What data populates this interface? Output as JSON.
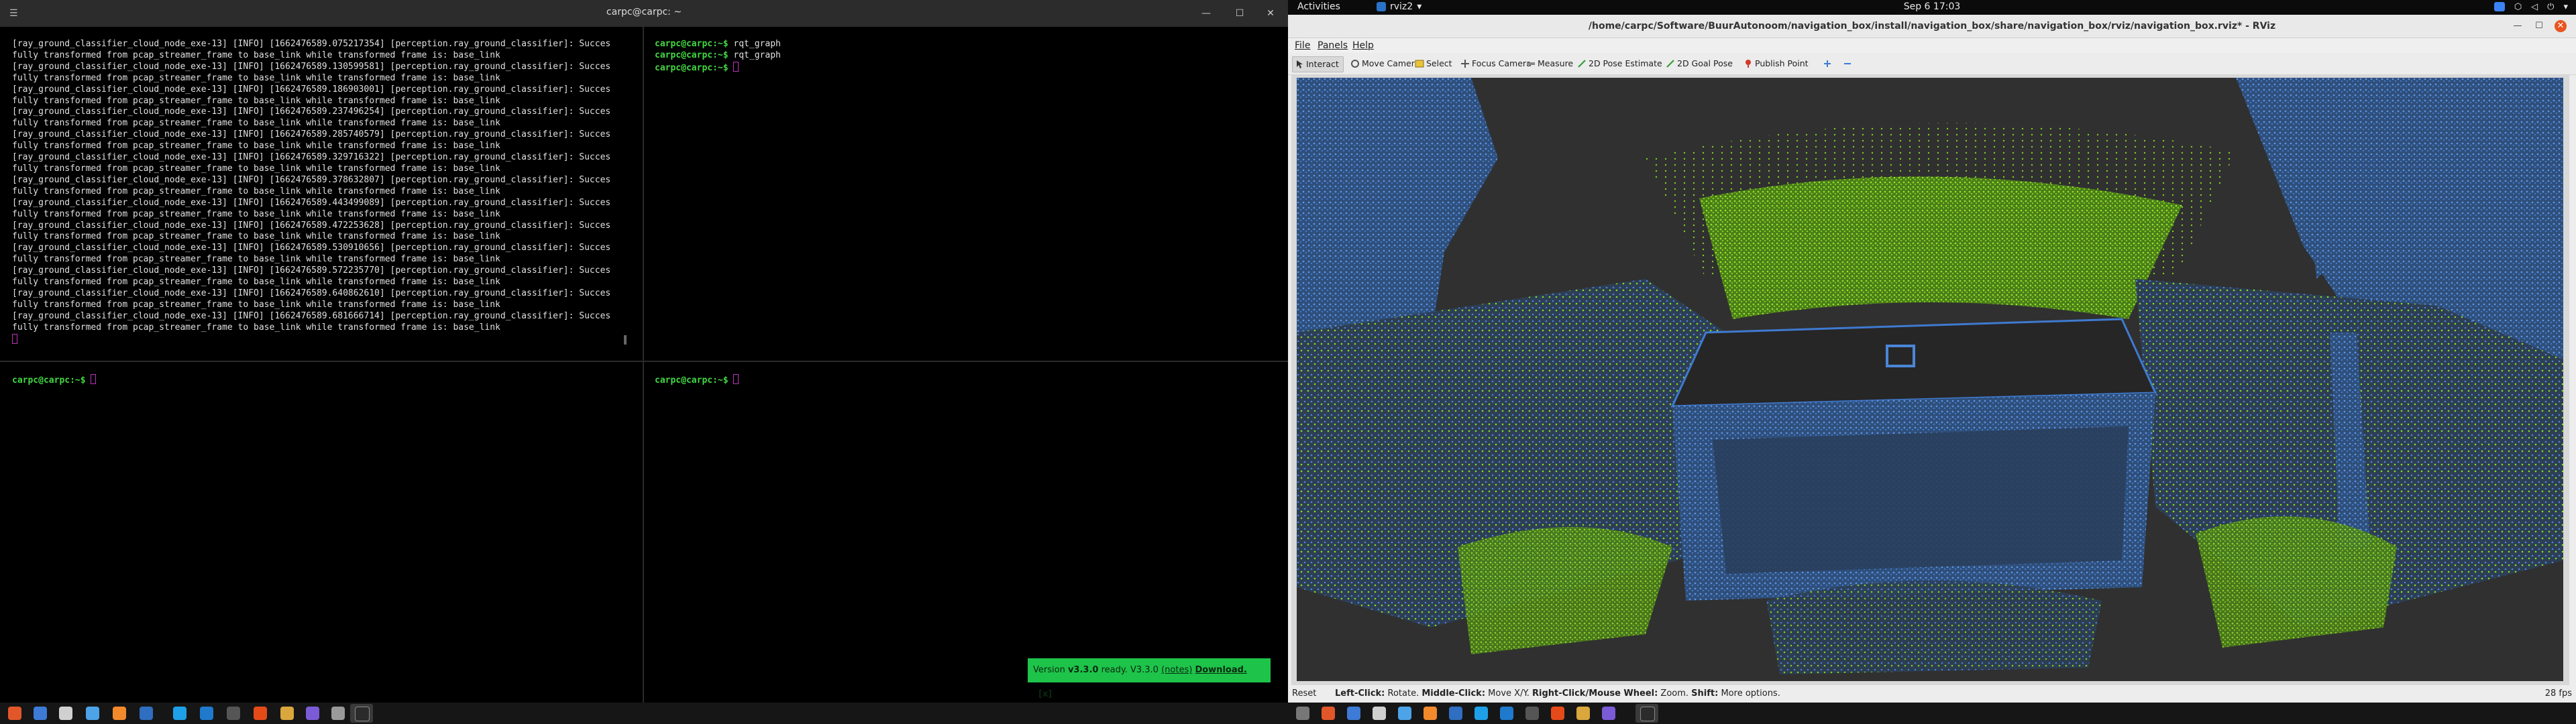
{
  "terminal": {
    "title": "carpc@carpc: ~",
    "menu_glyph": "☰",
    "btn_min": "—",
    "btn_max": "☐",
    "btn_close": "✕",
    "top_left_log": "[ray_ground_classifier_cloud_node_exe-13] [INFO] [1662476589.075217354] [perception.ray_ground_classifier]: Succes\nfully transformed from pcap_streamer_frame to base_link while transformed frame is: base_link\n[ray_ground_classifier_cloud_node_exe-13] [INFO] [1662476589.130599581] [perception.ray_ground_classifier]: Succes\nfully transformed from pcap_streamer_frame to base_link while transformed frame is: base_link\n[ray_ground_classifier_cloud_node_exe-13] [INFO] [1662476589.186903001] [perception.ray_ground_classifier]: Succes\nfully transformed from pcap_streamer_frame to base_link while transformed frame is: base_link\n[ray_ground_classifier_cloud_node_exe-13] [INFO] [1662476589.237496254] [perception.ray_ground_classifier]: Succes\nfully transformed from pcap_streamer_frame to base_link while transformed frame is: base_link\n[ray_ground_classifier_cloud_node_exe-13] [INFO] [1662476589.285740579] [perception.ray_ground_classifier]: Succes\nfully transformed from pcap_streamer_frame to base_link while transformed frame is: base_link\n[ray_ground_classifier_cloud_node_exe-13] [INFO] [1662476589.329716322] [perception.ray_ground_classifier]: Succes\nfully transformed from pcap_streamer_frame to base_link while transformed frame is: base_link\n[ray_ground_classifier_cloud_node_exe-13] [INFO] [1662476589.378632807] [perception.ray_ground_classifier]: Succes\nfully transformed from pcap_streamer_frame to base_link while transformed frame is: base_link\n[ray_ground_classifier_cloud_node_exe-13] [INFO] [1662476589.443499089] [perception.ray_ground_classifier]: Succes\nfully transformed from pcap_streamer_frame to base_link while transformed frame is: base_link\n[ray_ground_classifier_cloud_node_exe-13] [INFO] [1662476589.472253628] [perception.ray_ground_classifier]: Succes\nfully transformed from pcap_streamer_frame to base_link while transformed frame is: base_link\n[ray_ground_classifier_cloud_node_exe-13] [INFO] [1662476589.530910656] [perception.ray_ground_classifier]: Succes\nfully transformed from pcap_streamer_frame to base_link while transformed frame is: base_link\n[ray_ground_classifier_cloud_node_exe-13] [INFO] [1662476589.572235770] [perception.ray_ground_classifier]: Succes\nfully transformed from pcap_streamer_frame to base_link while transformed frame is: base_link\n[ray_ground_classifier_cloud_node_exe-13] [INFO] [1662476589.640862610] [perception.ray_ground_classifier]: Succes\nfully transformed from pcap_streamer_frame to base_link while transformed frame is: base_link\n[ray_ground_classifier_cloud_node_exe-13] [INFO] [1662476589.681666714] [perception.ray_ground_classifier]: Succes\nfully transformed from pcap_streamer_frame to base_link while transformed frame is: base_link",
    "prompt": "carpc@carpc:~$",
    "top_right_cmd": "rqt_graph"
  },
  "notice": {
    "prefix": "Version",
    "version": "v3.3.0",
    "ready": "ready. V3.3.0",
    "notes": "(notes)",
    "download": "Download.",
    "close": "[x]"
  },
  "gnome": {
    "activities": "Activities",
    "app_name": "rviz2",
    "app_arrow": "▾",
    "clock": "Sep 6  17:03"
  },
  "rviz": {
    "title": "/home/carpc/Software/BuurAutonoom/navigation_box/install/navigation_box/share/navigation_box/rviz/navigation_box.rviz* - RViz",
    "menu": {
      "file": "File",
      "panels": "Panels",
      "help": "Help"
    },
    "tools": {
      "interact": "Interact",
      "move_camera": "Move Camera",
      "select": "Select",
      "focus_camera": "Focus Camera",
      "measure": "Measure",
      "pose_estimate": "2D Pose Estimate",
      "goal_pose": "2D Goal Pose",
      "publish_point": "Publish Point"
    },
    "status": {
      "reset": "Reset",
      "help_left_b": "Left-Click:",
      "help_left": " Rotate. ",
      "help_mid_b": "Middle-Click:",
      "help_mid": " Move X/Y. ",
      "help_right_b": "Right-Click/Mouse Wheel:",
      "help_right": " Zoom. ",
      "help_shift_b": "Shift:",
      "help_shift": " More options.",
      "fps": "28 fps"
    }
  },
  "colors": {
    "prompt_green": "#43d843",
    "cloud_blue": "#3f7ad0",
    "cloud_green": "#86e020",
    "notice_green": "#1ec44a",
    "rviz_bg": "#303030"
  }
}
